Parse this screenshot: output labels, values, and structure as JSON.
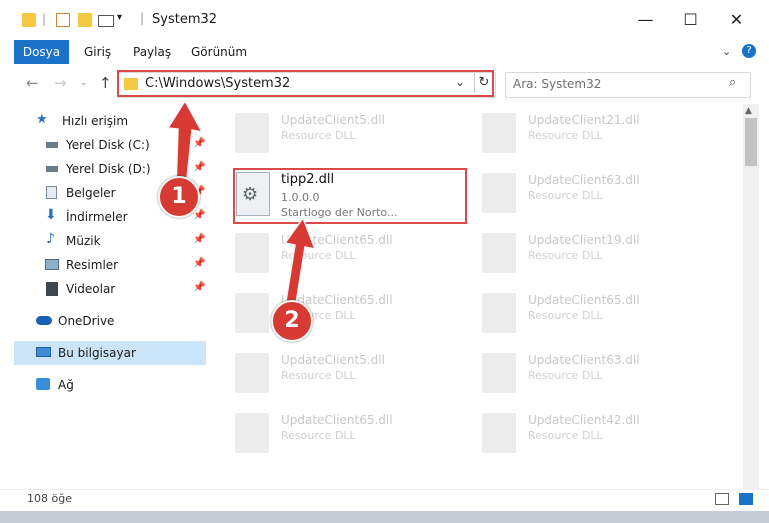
{
  "window": {
    "title": "System32"
  },
  "ribbon": {
    "tabs": [
      "Dosya",
      "Giriş",
      "Paylaş",
      "Görünüm"
    ]
  },
  "address": {
    "path": "C:\\Windows\\System32"
  },
  "search": {
    "placeholder": "Ara: System32"
  },
  "navpane": {
    "items": [
      {
        "label": "Hızlı erişim",
        "icon": "star-icon"
      },
      {
        "label": "Yerel Disk (C:)",
        "icon": "drive-icon"
      },
      {
        "label": "Yerel Disk (D:)",
        "icon": "drive-icon"
      },
      {
        "label": "Belgeler",
        "icon": "documents-icon"
      },
      {
        "label": "İndirmeler",
        "icon": "download-icon"
      },
      {
        "label": "Müzik",
        "icon": "music-icon"
      },
      {
        "label": "Resimler",
        "icon": "pictures-icon"
      },
      {
        "label": "Videolar",
        "icon": "video-icon"
      },
      {
        "label": "OneDrive",
        "icon": "cloud-icon"
      },
      {
        "label": "Bu bilgisayar",
        "icon": "computer-icon"
      },
      {
        "label": "Ağ",
        "icon": "network-icon"
      }
    ]
  },
  "files": {
    "highlighted": {
      "name": "tipp2.dll",
      "version": "1.0.0.0",
      "description": "Startlogo der Norto..."
    },
    "background": [
      {
        "name": "UpdateClient5.dll",
        "type": "Resource DLL"
      },
      {
        "name": "UpdateClient21.dll",
        "type": "Resource DLL"
      },
      {
        "name": "UpdateClient63.dll",
        "type": "Resource DLL"
      },
      {
        "name": "UpdateClient65.dll",
        "type": "Resource DLL"
      },
      {
        "name": "UpdateClient19.dll",
        "type": "Resource DLL"
      },
      {
        "name": "UpdateClient65.dll",
        "type": "Resource DLL"
      },
      {
        "name": "UpdateClient65.dll",
        "type": "Resource DLL"
      },
      {
        "name": "UpdateClient5.dll",
        "type": "Resource DLL"
      },
      {
        "name": "UpdateClient63.dll",
        "type": "Resource DLL"
      },
      {
        "name": "UpdateClient65.dll",
        "type": "Resource DLL"
      },
      {
        "name": "UpdateClient42.dll",
        "type": "Resource DLL"
      }
    ]
  },
  "status": {
    "count": "108 öğe"
  },
  "callouts": [
    "1",
    "2"
  ],
  "colors": {
    "accent": "#1a73c8",
    "highlight": "#d94a4a",
    "callout": "#d63a33"
  }
}
